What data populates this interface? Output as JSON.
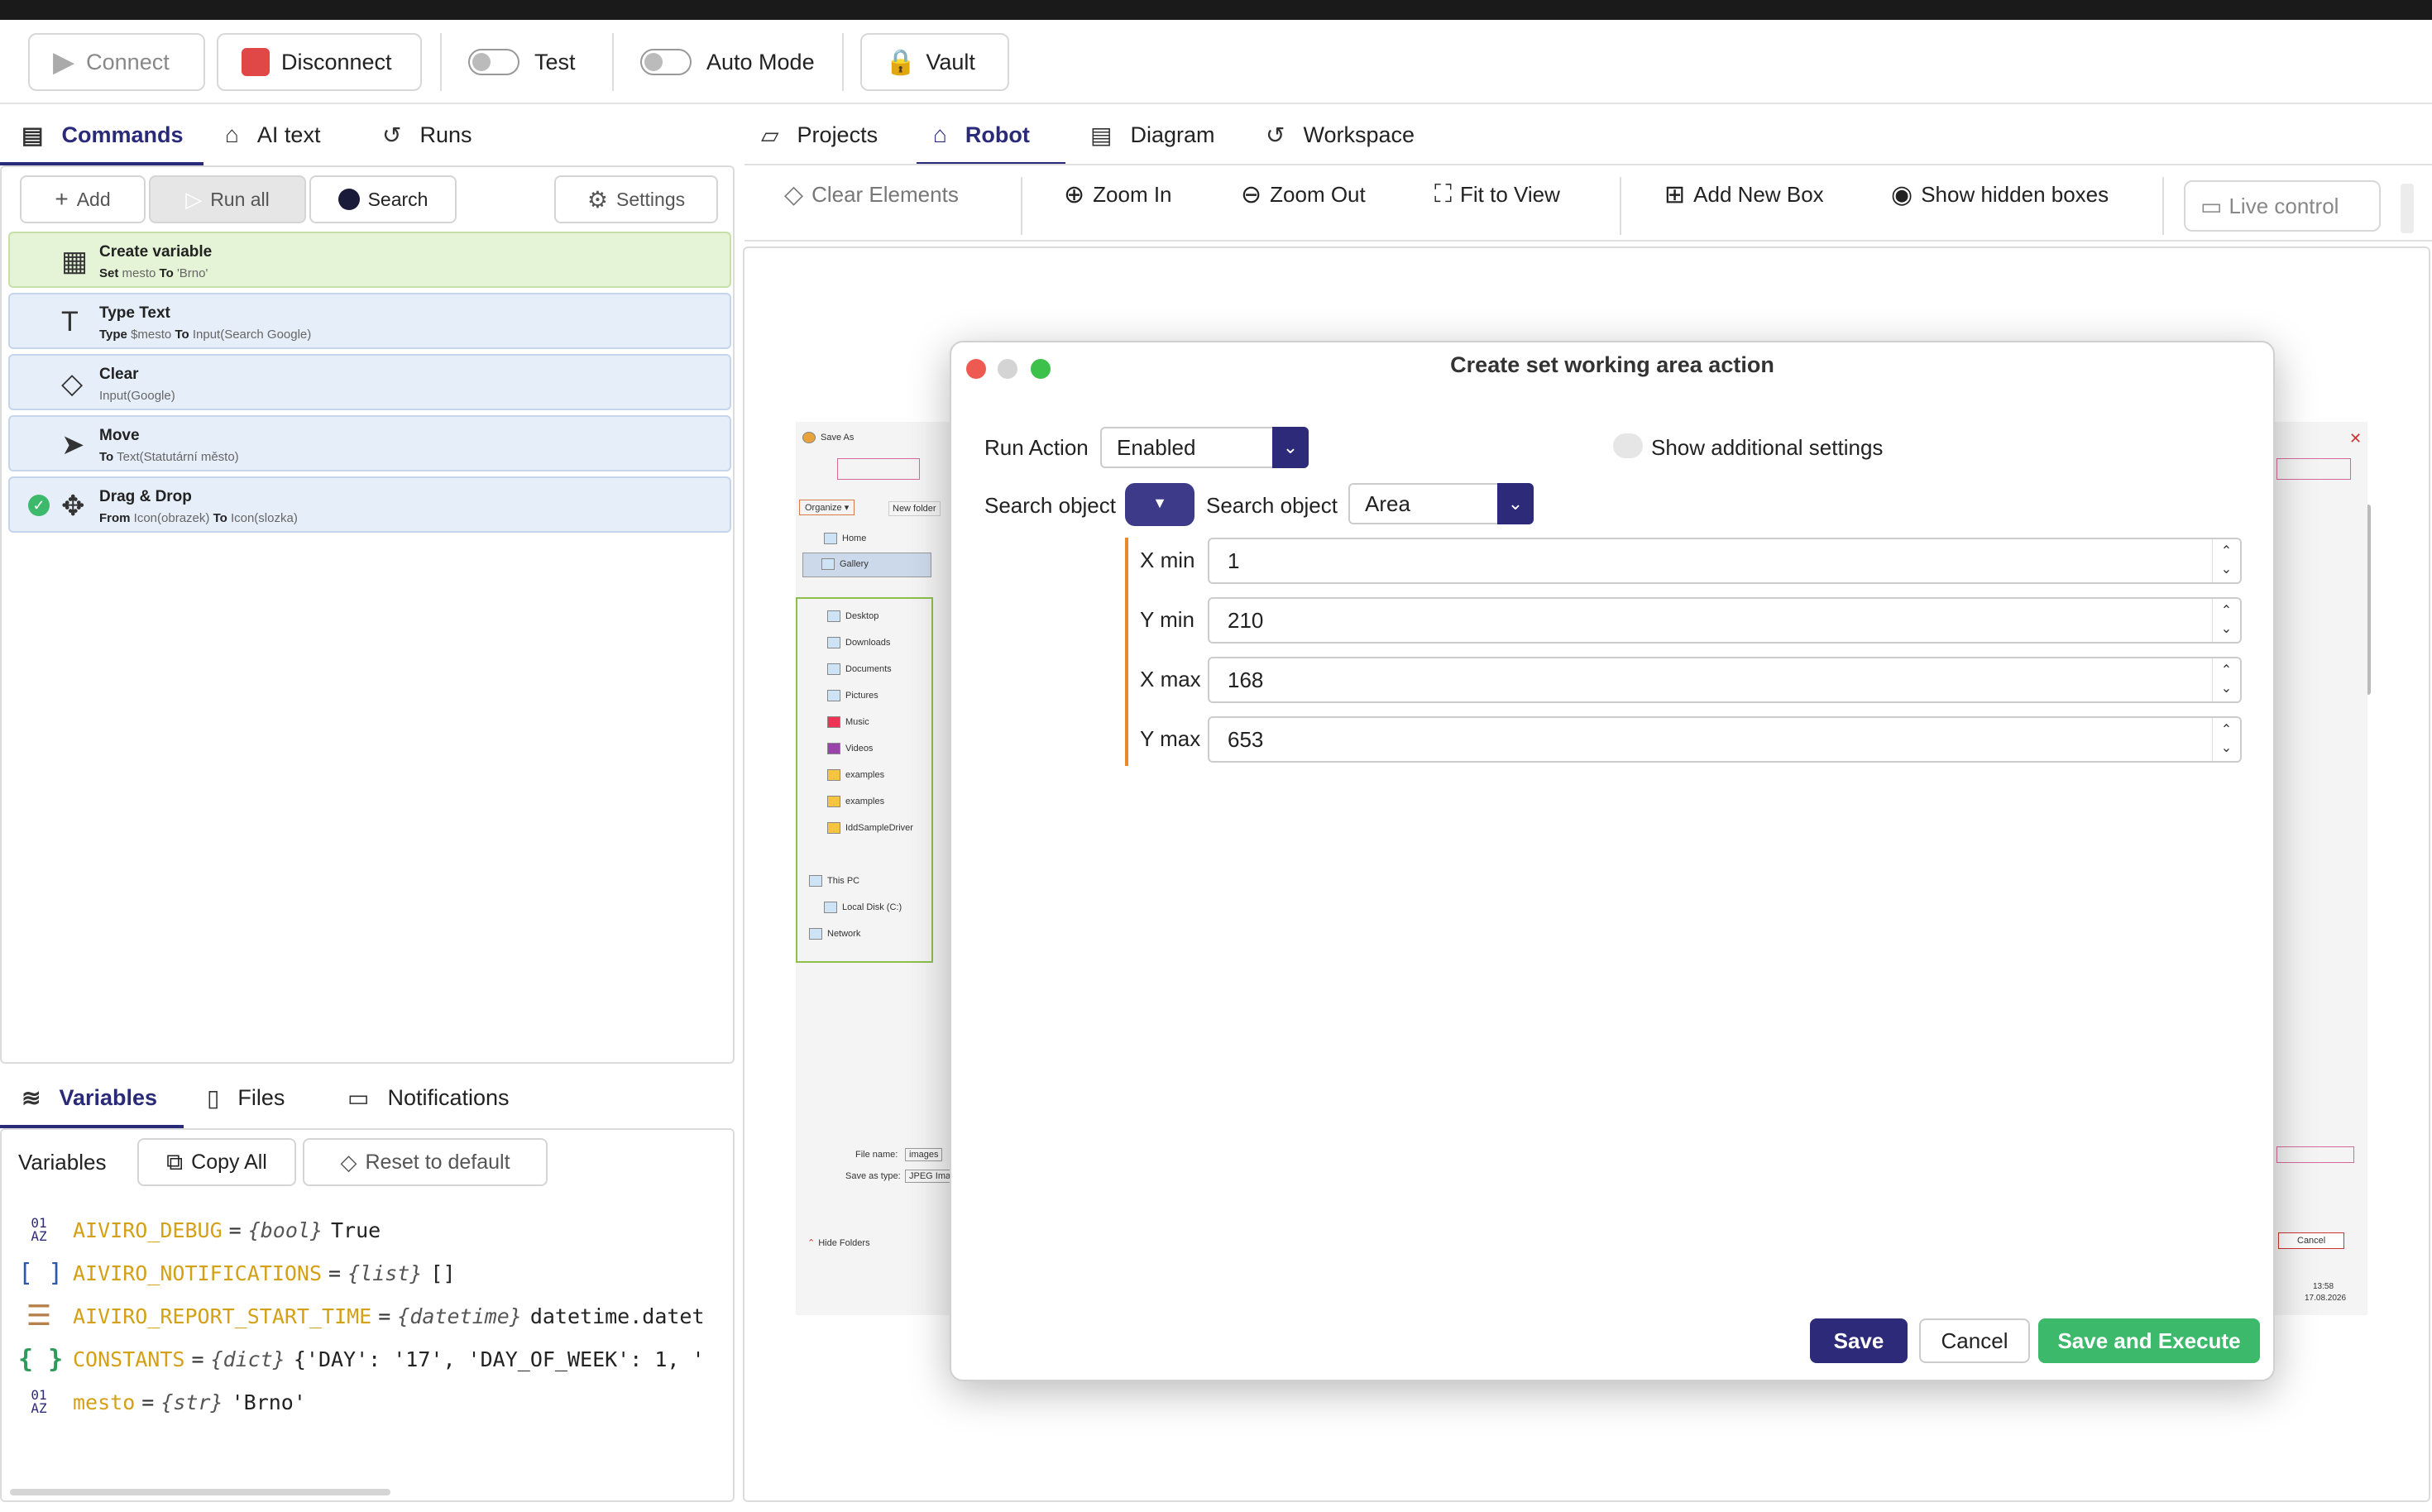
{
  "toolbar": {
    "connect": "Connect",
    "disconnect": "Disconnect",
    "test": "Test",
    "auto_mode": "Auto Mode",
    "vault": "Vault"
  },
  "left_tabs": [
    "Commands",
    "AI text",
    "Runs"
  ],
  "commands_toolbar": {
    "add": "Add",
    "run_all": "Run all",
    "search": "Search",
    "settings": "Settings"
  },
  "commands": [
    {
      "title": "Create variable",
      "sub": [
        [
          "Set",
          "mesto"
        ],
        [
          "To",
          "'Brno'"
        ]
      ]
    },
    {
      "title": "Type Text",
      "sub": [
        [
          "Type",
          "$mesto"
        ],
        [
          "To",
          "Input(Search Google)"
        ]
      ]
    },
    {
      "title": "Clear",
      "sub": [
        [
          "",
          "Input(Google)"
        ]
      ]
    },
    {
      "title": "Move",
      "sub": [
        [
          "To",
          "Text(Statutární město)"
        ]
      ]
    },
    {
      "title": "Drag & Drop",
      "sub": [
        [
          "From",
          "Icon(obrazek)"
        ],
        [
          "To",
          "Icon(slozka)"
        ]
      ]
    }
  ],
  "bottom_tabs": [
    "Variables",
    "Files",
    "Notifications"
  ],
  "variables_toolbar": {
    "label": "Variables",
    "copy_all": "Copy All",
    "reset": "Reset to default"
  },
  "variables": [
    {
      "name": "AIVIRO_DEBUG",
      "type": "{bool}",
      "value": "True",
      "icon": "01\nAZ"
    },
    {
      "name": "AIVIRO_NOTIFICATIONS",
      "type": "{list}",
      "value": "[]",
      "icon": "[ ]"
    },
    {
      "name": "AIVIRO_REPORT_START_TIME",
      "type": "{datetime}",
      "value": "datetime.datet",
      "icon": "☰"
    },
    {
      "name": "CONSTANTS",
      "type": "{dict}",
      "value": "{'DAY': '17', 'DAY_OF_WEEK': 1, '",
      "icon": "{ }"
    },
    {
      "name": "mesto",
      "type": "{str}",
      "value": "'Brno'",
      "icon": "01\nAZ"
    }
  ],
  "right_tabs": [
    "Projects",
    "Robot",
    "Diagram",
    "Workspace"
  ],
  "robot_toolbar": {
    "clear": "Clear Elements",
    "zoom_in": "Zoom In",
    "zoom_out": "Zoom Out",
    "fit": "Fit to View",
    "add_box": "Add New Box",
    "show_hidden": "Show hidden boxes",
    "live": "Live control"
  },
  "preview": {
    "save_as": "Save As",
    "organize": "Organize ▾",
    "new_folder": "New folder",
    "home": "Home",
    "gallery": "Gallery",
    "items": [
      "Desktop",
      "Downloads",
      "Documents",
      "Pictures",
      "Music",
      "Videos",
      "examples",
      "examples",
      "IddSampleDriver"
    ],
    "this_pc": "This PC",
    "local_disk": "Local Disk (C:)",
    "network": "Network",
    "file_name_label": "File name:",
    "file_name_value": "images",
    "save_type_label": "Save as type:",
    "save_type_value": "JPEG Imag",
    "hide_folders": "Hide Folders",
    "cancel": "Cancel",
    "time": "13:58",
    "date": "17.08.2026"
  },
  "dialog": {
    "title": "Create set working area action",
    "run_action_label": "Run Action",
    "run_action_value": "Enabled",
    "show_additional": "Show additional settings",
    "search_object_label": "Search object",
    "search_object_label2": "Search object",
    "search_object_value": "Area",
    "fields": [
      {
        "label": "X min",
        "value": "1"
      },
      {
        "label": "Y min",
        "value": "210"
      },
      {
        "label": "X max",
        "value": "168"
      },
      {
        "label": "Y max",
        "value": "653"
      }
    ],
    "save": "Save",
    "cancel": "Cancel",
    "save_execute": "Save and Execute"
  },
  "colors": {
    "accent": "#2d2a7a",
    "green": "#3cb96b",
    "field_bar": "#e8892f"
  }
}
